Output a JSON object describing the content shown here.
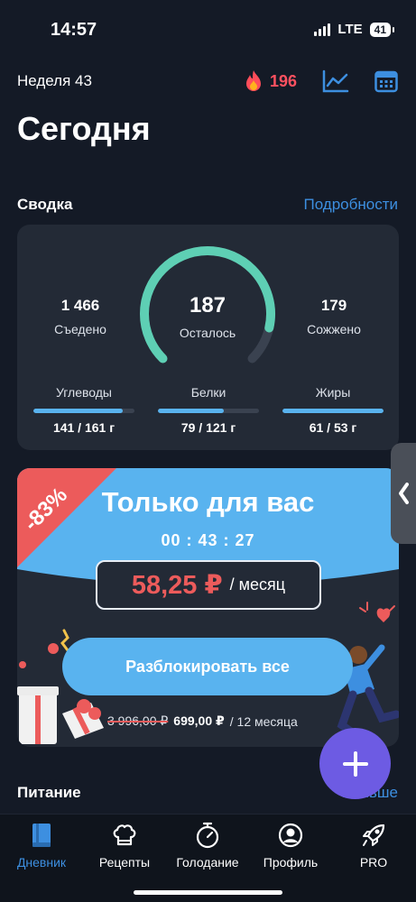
{
  "status": {
    "time": "14:57",
    "network": "LTE",
    "battery": "41"
  },
  "header": {
    "week": "Неделя 43",
    "streak": "196",
    "title": "Сегодня"
  },
  "summary": {
    "heading": "Сводка",
    "details_link": "Подробности",
    "eaten": {
      "value": "1 466",
      "label": "Съедено"
    },
    "remaining": {
      "value": "187",
      "label": "Осталось",
      "gauge_fraction": 0.88
    },
    "burned": {
      "value": "179",
      "label": "Сожжено"
    },
    "macros": [
      {
        "label": "Углеводы",
        "value": "141 / 161 г",
        "fraction": 0.88
      },
      {
        "label": "Белки",
        "value": "79 / 121 г",
        "fraction": 0.65
      },
      {
        "label": "Жиры",
        "value": "61 / 53 г",
        "fraction": 1.0
      }
    ]
  },
  "promo": {
    "badge": "-83%",
    "title": "Только для вас",
    "timer": "00 : 43 : 27",
    "price": "58,25 ₽",
    "per": "/ месяц",
    "button": "Разблокировать все",
    "old_price": "3 996,00 ₽",
    "new_price": "699,00 ₽",
    "period": "/ 12 месяца"
  },
  "nutrition": {
    "heading": "Питание",
    "more_link": "Больше"
  },
  "tabs": [
    {
      "label": "Дневник",
      "icon": "book-icon",
      "active": true
    },
    {
      "label": "Рецепты",
      "icon": "chef-hat-icon",
      "active": false
    },
    {
      "label": "Голодание",
      "icon": "stopwatch-icon",
      "active": false
    },
    {
      "label": "Профиль",
      "icon": "profile-icon",
      "active": false
    },
    {
      "label": "PRO",
      "icon": "rocket-icon",
      "active": false
    }
  ],
  "colors": {
    "accent": "#3d8fe0",
    "gauge": "#5ecfb4",
    "promo_blue": "#59b3ef",
    "badge_red": "#ec5b5b",
    "fab": "#6d5be3"
  }
}
